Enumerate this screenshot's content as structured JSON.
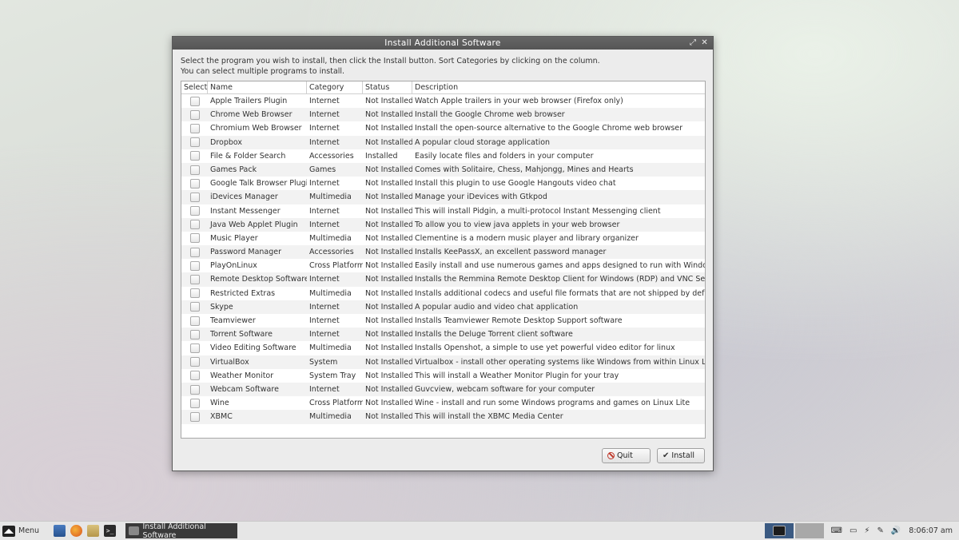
{
  "window": {
    "title": "Install Additional Software",
    "intro_line1": "Select the program you wish to install, then click the Install button. Sort Categories by clicking on the column.",
    "intro_line2": "You can select multiple programs to install."
  },
  "table": {
    "columns": [
      "Select",
      "Name",
      "Category",
      "Status",
      "Description"
    ],
    "rows": [
      {
        "name": "Apple Trailers Plugin",
        "category": "Internet",
        "status": "Not Installed",
        "description": "Watch Apple trailers in your web browser (Firefox only)"
      },
      {
        "name": "Chrome Web Browser",
        "category": "Internet",
        "status": "Not Installed",
        "description": "Install the Google Chrome web browser"
      },
      {
        "name": "Chromium Web Browser",
        "category": "Internet",
        "status": "Not Installed",
        "description": "Install the open-source alternative to the Google Chrome web browser"
      },
      {
        "name": "Dropbox",
        "category": "Internet",
        "status": "Not Installed",
        "description": "A popular cloud storage application"
      },
      {
        "name": "File & Folder Search",
        "category": "Accessories",
        "status": "Installed",
        "description": "Easily locate files and folders in your computer"
      },
      {
        "name": "Games Pack",
        "category": "Games",
        "status": "Not Installed",
        "description": "Comes with Solitaire, Chess, Mahjongg, Mines and Hearts"
      },
      {
        "name": "Google Talk Browser Plugin",
        "category": "Internet",
        "status": "Not Installed",
        "description": "Install this plugin to use Google Hangouts video chat"
      },
      {
        "name": "iDevices Manager",
        "category": "Multimedia",
        "status": "Not Installed",
        "description": "Manage your iDevices with Gtkpod"
      },
      {
        "name": "Instant Messenger",
        "category": "Internet",
        "status": "Not Installed",
        "description": "This will install Pidgin, a multi-protocol Instant Messenging client"
      },
      {
        "name": "Java Web Applet Plugin",
        "category": "Internet",
        "status": "Not Installed",
        "description": "To allow you to view java applets in your web browser"
      },
      {
        "name": "Music Player",
        "category": "Multimedia",
        "status": "Not Installed",
        "description": "Clementine is a modern music player and library organizer"
      },
      {
        "name": "Password Manager",
        "category": "Accessories",
        "status": "Not Installed",
        "description": "Installs KeePassX, an excellent password manager"
      },
      {
        "name": "PlayOnLinux",
        "category": "Cross Platform",
        "status": "Not Installed",
        "description": "Easily install and use numerous games and apps designed to run with Windows"
      },
      {
        "name": "Remote Desktop Software",
        "category": "Internet",
        "status": "Not Installed",
        "description": "Installs the Remmina Remote Desktop Client for Windows (RDP) and VNC Servers"
      },
      {
        "name": "Restricted Extras",
        "category": "Multimedia",
        "status": "Not Installed",
        "description": "Installs additional codecs and useful file formats that are not shipped by default"
      },
      {
        "name": "Skype",
        "category": "Internet",
        "status": "Not Installed",
        "description": "A popular audio and video chat application"
      },
      {
        "name": "Teamviewer",
        "category": "Internet",
        "status": "Not Installed",
        "description": "Installs Teamviewer Remote Desktop Support software"
      },
      {
        "name": "Torrent Software",
        "category": "Internet",
        "status": "Not Installed",
        "description": "Installs the Deluge Torrent client software"
      },
      {
        "name": "Video Editing Software",
        "category": "Multimedia",
        "status": "Not Installed",
        "description": "Installs Openshot, a simple to use yet powerful video editor for linux"
      },
      {
        "name": "VirtualBox",
        "category": "System",
        "status": "Not Installed",
        "description": "Virtualbox - install other operating systems like Windows from within Linux Lite"
      },
      {
        "name": "Weather Monitor",
        "category": "System Tray",
        "status": "Not Installed",
        "description": "This will install a Weather Monitor Plugin for your tray"
      },
      {
        "name": "Webcam Software",
        "category": "Internet",
        "status": "Not Installed",
        "description": "Guvcview, webcam software for your computer"
      },
      {
        "name": "Wine",
        "category": "Cross Platform",
        "status": "Not Installed",
        "description": "Wine - install and run some Windows programs and games on Linux Lite"
      },
      {
        "name": "XBMC",
        "category": "Multimedia",
        "status": "Not Installed",
        "description": "This will install the XBMC Media Center"
      }
    ]
  },
  "buttons": {
    "quit": "Quit",
    "install": "Install"
  },
  "taskbar": {
    "menu_label": "Menu",
    "task_label": "Install Additional Software",
    "clock": "8:06:07 am"
  }
}
